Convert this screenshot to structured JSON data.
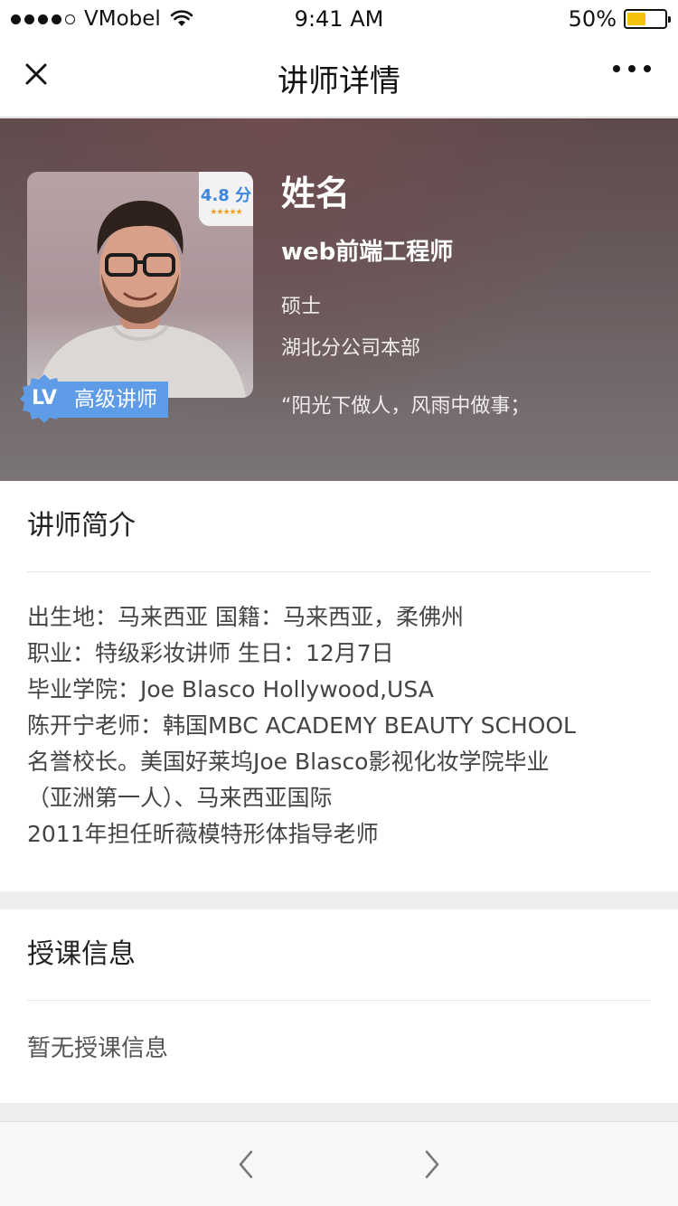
{
  "status_bar": {
    "carrier": "VMobel",
    "time": "9:41 AM",
    "battery": "50%",
    "battery_level": 0.5,
    "signal_bars": 4
  },
  "nav": {
    "title": "讲师详情",
    "close_icon": "close-icon",
    "more_icon": "more-icon"
  },
  "teacher": {
    "score": "4.8 分",
    "stars": "★★★★★",
    "level_badge": "LV",
    "level_label": "高级讲师",
    "name": "姓名",
    "title": "web前端工程师",
    "degree": "硕士",
    "department": "湖北分公司本部",
    "motto": "“阳光下做人，风雨中做事；"
  },
  "intro": {
    "heading": "讲师简介",
    "lines": [
      "出生地：马来西亚 国籍：马来西亚，柔佛州",
      "职业：特级彩妆讲师 生日：12月7日",
      "毕业学院：Joe Blasco Hollywood,USA",
      "陈开宁老师：韩国MBC ACADEMY BEAUTY SCHOOL",
      "名誉校长。美国好莱坞Joe Blasco影视化妆学院毕业",
      "（亚洲第一人）、马来西亚国际",
      "2011年担任昕薇模特形体指导老师"
    ]
  },
  "course": {
    "heading": "授课信息",
    "empty_text": "暂无授课信息"
  },
  "colors": {
    "accent_blue": "#5e9ce8",
    "score_blue": "#3d86e0",
    "battery_yellow": "#f4c20d"
  }
}
